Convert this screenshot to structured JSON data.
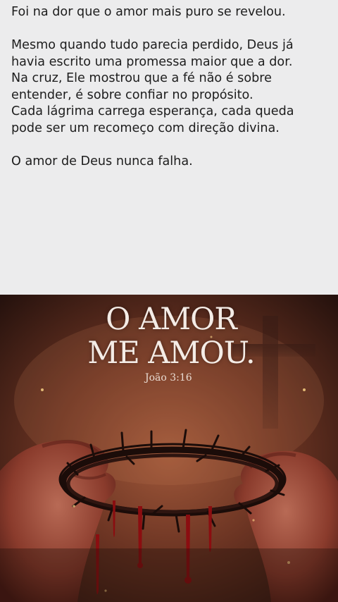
{
  "post": {
    "paragraph1": "Foi na dor que o amor mais puro se revelou.",
    "paragraph2_lines": [
      "Mesmo quando tudo parecia perdido, Deus já",
      "havia escrito uma promessa maior que a dor.",
      "Na cruz, Ele mostrou que a fé não é sobre",
      "entender, é sobre confiar no propósito.",
      "Cada lágrima carrega esperança, cada queda",
      "pode ser um recomeço com direção divina."
    ],
    "paragraph3": "O amor de Deus nunca falha."
  },
  "image": {
    "title_line1": "O AMOR",
    "title_line2": "ME AMOU.",
    "reference": "João 3:16",
    "icons": [
      "cross-icon",
      "crown-of-thorns",
      "hands"
    ],
    "colors": {
      "background_top": "#ececed",
      "image_dark": "#2a1410",
      "image_warm": "#8a4a32",
      "blood": "#8b0d10",
      "title_text": "#f4ece6"
    }
  }
}
